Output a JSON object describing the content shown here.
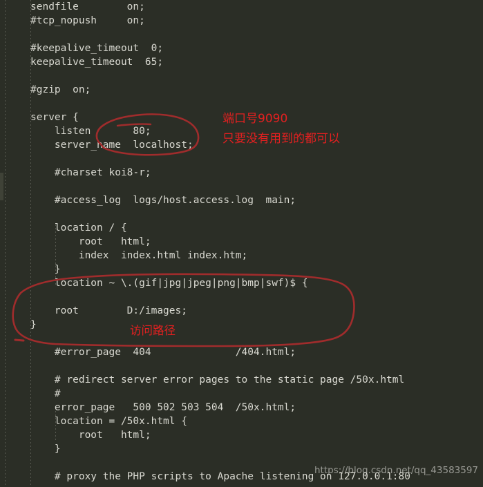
{
  "window": {
    "background_color": "#2b2e26",
    "code_text_color": "#d9d9d1",
    "annotation_ink_color": "#a02c2c",
    "annotation_text_color": "#e42020",
    "watermark_color": "#e4e4de"
  },
  "editor": {
    "language": "nginx-conf",
    "lines": [
      "    sendfile        on;",
      "    #tcp_nopush     on;",
      "",
      "    #keepalive_timeout  0;",
      "    keepalive_timeout  65;",
      "",
      "    #gzip  on;",
      "",
      "    server {",
      "        listen       80;",
      "        server_name  localhost;",
      "",
      "        #charset koi8-r;",
      "",
      "        #access_log  logs/host.access.log  main;",
      "",
      "        location / {",
      "            root   html;",
      "            index  index.html index.htm;",
      "        }",
      "        location ~ \\.(gif|jpg|jpeg|png|bmp|swf)$ {",
      "",
      "        root        D:/images;",
      "}",
      "",
      "        #error_page  404              /404.html;",
      "",
      "        # redirect server error pages to the static page /50x.html",
      "        #",
      "        error_page   500 502 503 504  /50x.html;",
      "        location = /50x.html {",
      "            root   html;",
      "        }",
      "",
      "        # proxy the PHP scripts to Apache listening on 127.0.0.1:80"
    ]
  },
  "annotations": {
    "port_note": "端口号9090",
    "port_note_sub": "只要没有用到的都可以",
    "path_note": "访问路径",
    "circle_listen_label": "circle-around-listen-80",
    "circle_location_label": "circle-around-image-location-block"
  },
  "watermark": {
    "text": "https://blog.csdn.net/qq_43583597"
  }
}
